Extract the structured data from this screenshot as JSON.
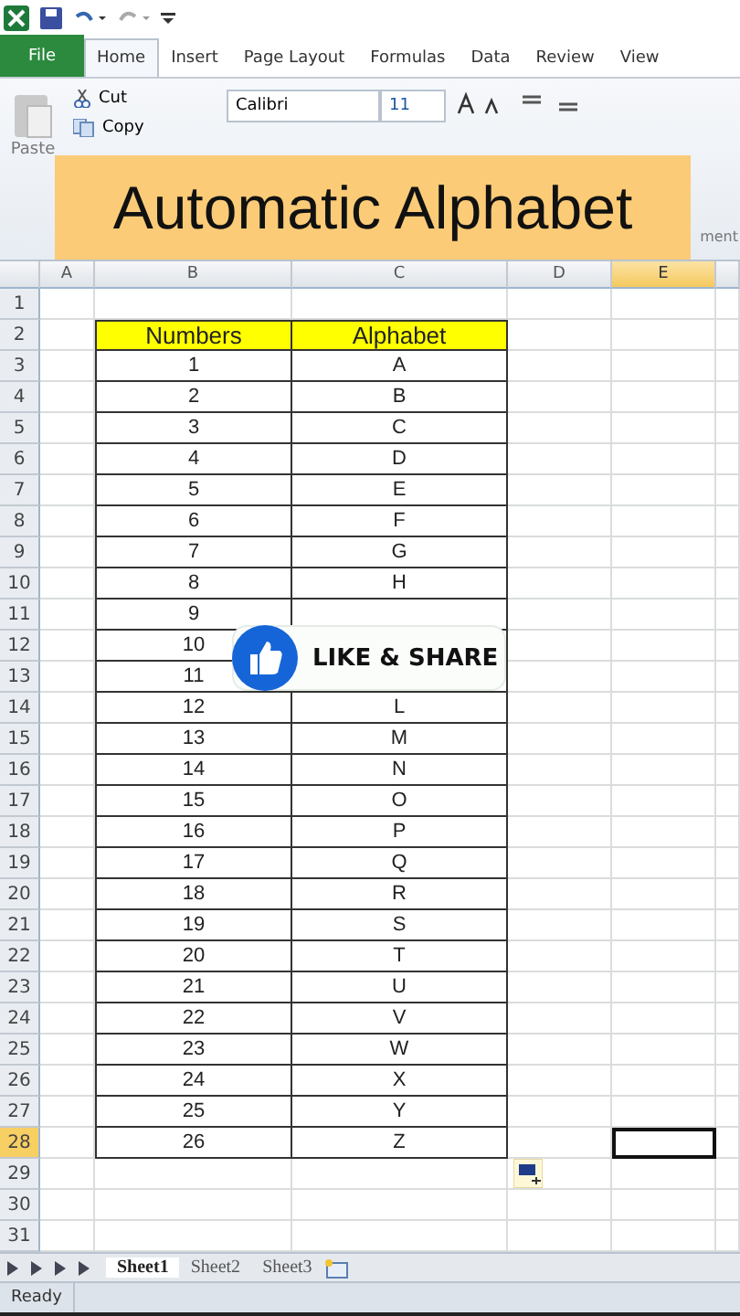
{
  "tabs": [
    {
      "label": "File",
      "kind": "file",
      "selected": false
    },
    {
      "label": "Home",
      "kind": "tab",
      "selected": true
    },
    {
      "label": "Insert",
      "kind": "tab",
      "selected": false
    },
    {
      "label": "Page Layout",
      "kind": "tab",
      "selected": false
    },
    {
      "label": "Formulas",
      "kind": "tab",
      "selected": false
    },
    {
      "label": "Data",
      "kind": "tab",
      "selected": false
    },
    {
      "label": "Review",
      "kind": "tab",
      "selected": false
    },
    {
      "label": "View",
      "kind": "tab",
      "selected": false
    }
  ],
  "ribbon": {
    "paste": "Paste",
    "cut": "Cut",
    "copy": "Copy",
    "font": "Calibri",
    "size": "11",
    "group_label": "ment"
  },
  "banner": "Automatic Alphabet",
  "columns": [
    {
      "label": "A",
      "selected": false
    },
    {
      "label": "B",
      "selected": false
    },
    {
      "label": "C",
      "selected": false
    },
    {
      "label": "D",
      "selected": false
    },
    {
      "label": "E",
      "selected": true
    }
  ],
  "rows": [
    {
      "label": "1",
      "selected": false,
      "kind": "empty"
    },
    {
      "label": "2",
      "selected": false,
      "kind": "header",
      "b": "Numbers",
      "c": "Alphabet"
    },
    {
      "label": "3",
      "selected": false,
      "kind": "data",
      "b": "1",
      "c": "A"
    },
    {
      "label": "4",
      "selected": false,
      "kind": "data",
      "b": "2",
      "c": "B"
    },
    {
      "label": "5",
      "selected": false,
      "kind": "data",
      "b": "3",
      "c": "C"
    },
    {
      "label": "6",
      "selected": false,
      "kind": "data",
      "b": "4",
      "c": "D"
    },
    {
      "label": "7",
      "selected": false,
      "kind": "data",
      "b": "5",
      "c": "E"
    },
    {
      "label": "8",
      "selected": false,
      "kind": "data",
      "b": "6",
      "c": "F"
    },
    {
      "label": "9",
      "selected": false,
      "kind": "data",
      "b": "7",
      "c": "G"
    },
    {
      "label": "10",
      "selected": false,
      "kind": "data",
      "b": "8",
      "c": "H"
    },
    {
      "label": "11",
      "selected": false,
      "kind": "data",
      "b": "9"
    },
    {
      "label": "12",
      "selected": false,
      "kind": "data",
      "b": "10"
    },
    {
      "label": "13",
      "selected": false,
      "kind": "data",
      "b": "11"
    },
    {
      "label": "14",
      "selected": false,
      "kind": "data",
      "b": "12",
      "c": "L"
    },
    {
      "label": "15",
      "selected": false,
      "kind": "data",
      "b": "13",
      "c": "M"
    },
    {
      "label": "16",
      "selected": false,
      "kind": "data",
      "b": "14",
      "c": "N"
    },
    {
      "label": "17",
      "selected": false,
      "kind": "data",
      "b": "15",
      "c": "O"
    },
    {
      "label": "18",
      "selected": false,
      "kind": "data",
      "b": "16",
      "c": "P"
    },
    {
      "label": "19",
      "selected": false,
      "kind": "data",
      "b": "17",
      "c": "Q"
    },
    {
      "label": "20",
      "selected": false,
      "kind": "data",
      "b": "18",
      "c": "R"
    },
    {
      "label": "21",
      "selected": false,
      "kind": "data",
      "b": "19",
      "c": "S"
    },
    {
      "label": "22",
      "selected": false,
      "kind": "data",
      "b": "20",
      "c": "T"
    },
    {
      "label": "23",
      "selected": false,
      "kind": "data",
      "b": "21",
      "c": "U"
    },
    {
      "label": "24",
      "selected": false,
      "kind": "data",
      "b": "22",
      "c": "V"
    },
    {
      "label": "25",
      "selected": false,
      "kind": "data",
      "b": "23",
      "c": "W"
    },
    {
      "label": "26",
      "selected": false,
      "kind": "data",
      "b": "24",
      "c": "X"
    },
    {
      "label": "27",
      "selected": false,
      "kind": "data",
      "b": "25",
      "c": "Y"
    },
    {
      "label": "28",
      "selected": true,
      "kind": "data",
      "b": "26",
      "c": "Z"
    },
    {
      "label": "29",
      "selected": false,
      "kind": "empty"
    },
    {
      "label": "30",
      "selected": false,
      "kind": "empty"
    },
    {
      "label": "31",
      "selected": false,
      "kind": "empty"
    }
  ],
  "like_button": "LIKE & SHARE",
  "sheet_tabs": [
    {
      "label": "Sheet1",
      "selected": true
    },
    {
      "label": "Sheet2",
      "selected": false
    },
    {
      "label": "Sheet3",
      "selected": false
    }
  ],
  "status_bar": "Ready"
}
